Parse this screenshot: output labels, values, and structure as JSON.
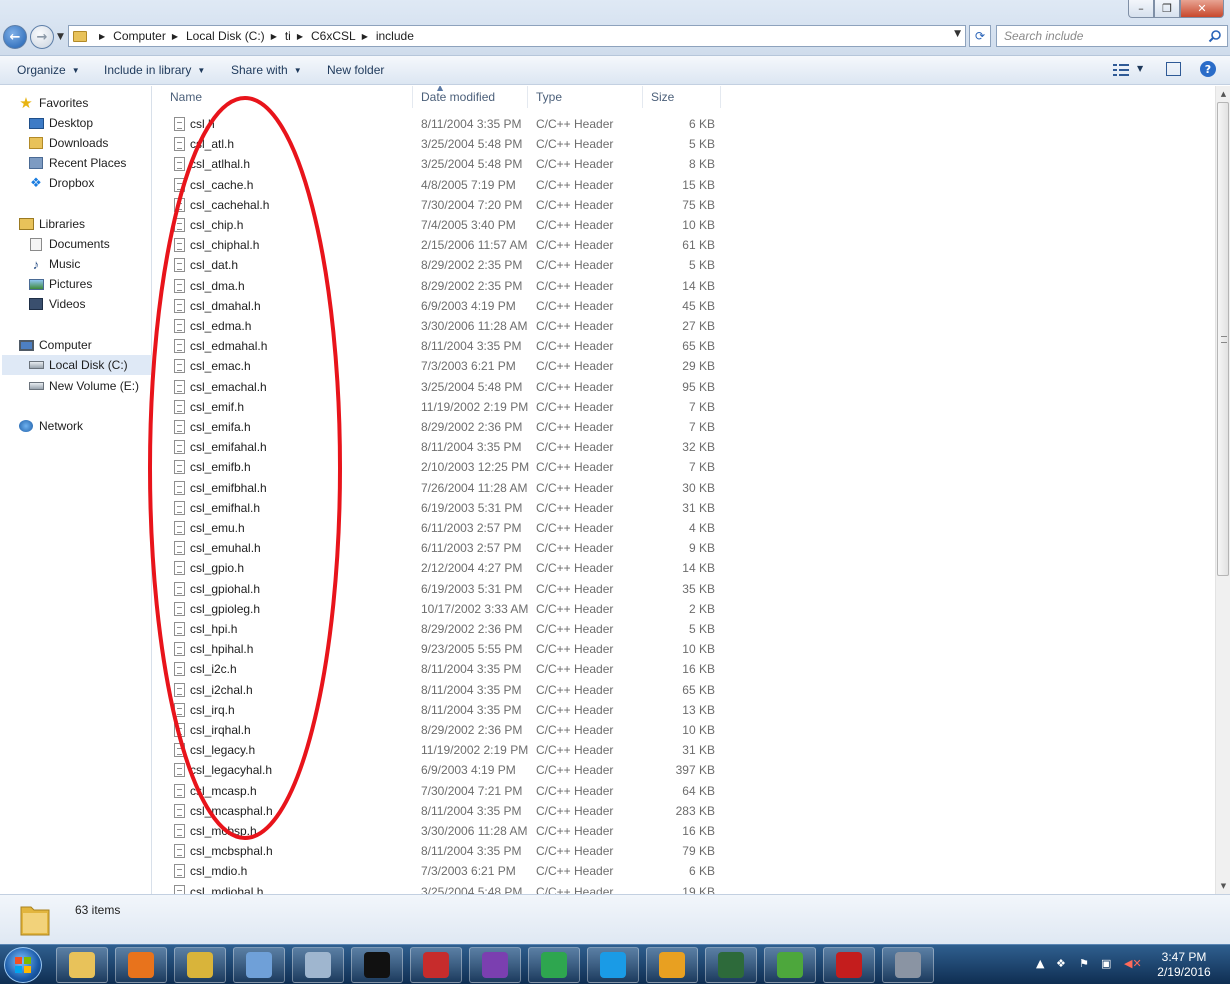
{
  "window": {
    "minimize": "–",
    "maximize": "❐",
    "close": "✕"
  },
  "address": {
    "breadcrumb": [
      "Computer",
      "Local Disk (C:)",
      "ti",
      "C6xCSL",
      "include"
    ],
    "search_placeholder": "Search include"
  },
  "toolbar": {
    "organize": "Organize",
    "include_in_library": "Include in library",
    "share_with": "Share with",
    "new_folder": "New folder"
  },
  "nav": {
    "favorites": "Favorites",
    "desktop": "Desktop",
    "downloads": "Downloads",
    "recent_places": "Recent Places",
    "dropbox": "Dropbox",
    "libraries": "Libraries",
    "documents": "Documents",
    "music": "Music",
    "pictures": "Pictures",
    "videos": "Videos",
    "computer": "Computer",
    "local_disk": "Local Disk (C:)",
    "new_volume": "New Volume (E:)",
    "network": "Network"
  },
  "columns": {
    "name": "Name",
    "date_modified": "Date modified",
    "type": "Type",
    "size": "Size"
  },
  "files": [
    {
      "name": "csl.h",
      "date": "8/11/2004 3:35 PM",
      "type": "C/C++ Header",
      "size": "6 KB"
    },
    {
      "name": "csl_atl.h",
      "date": "3/25/2004 5:48 PM",
      "type": "C/C++ Header",
      "size": "5 KB"
    },
    {
      "name": "csl_atlhal.h",
      "date": "3/25/2004 5:48 PM",
      "type": "C/C++ Header",
      "size": "8 KB"
    },
    {
      "name": "csl_cache.h",
      "date": "4/8/2005 7:19 PM",
      "type": "C/C++ Header",
      "size": "15 KB"
    },
    {
      "name": "csl_cachehal.h",
      "date": "7/30/2004 7:20 PM",
      "type": "C/C++ Header",
      "size": "75 KB"
    },
    {
      "name": "csl_chip.h",
      "date": "7/4/2005 3:40 PM",
      "type": "C/C++ Header",
      "size": "10 KB"
    },
    {
      "name": "csl_chiphal.h",
      "date": "2/15/2006 11:57 AM",
      "type": "C/C++ Header",
      "size": "61 KB"
    },
    {
      "name": "csl_dat.h",
      "date": "8/29/2002 2:35 PM",
      "type": "C/C++ Header",
      "size": "5 KB"
    },
    {
      "name": "csl_dma.h",
      "date": "8/29/2002 2:35 PM",
      "type": "C/C++ Header",
      "size": "14 KB"
    },
    {
      "name": "csl_dmahal.h",
      "date": "6/9/2003 4:19 PM",
      "type": "C/C++ Header",
      "size": "45 KB"
    },
    {
      "name": "csl_edma.h",
      "date": "3/30/2006 11:28 AM",
      "type": "C/C++ Header",
      "size": "27 KB"
    },
    {
      "name": "csl_edmahal.h",
      "date": "8/11/2004 3:35 PM",
      "type": "C/C++ Header",
      "size": "65 KB"
    },
    {
      "name": "csl_emac.h",
      "date": "7/3/2003 6:21 PM",
      "type": "C/C++ Header",
      "size": "29 KB"
    },
    {
      "name": "csl_emachal.h",
      "date": "3/25/2004 5:48 PM",
      "type": "C/C++ Header",
      "size": "95 KB"
    },
    {
      "name": "csl_emif.h",
      "date": "11/19/2002 2:19 PM",
      "type": "C/C++ Header",
      "size": "7 KB"
    },
    {
      "name": "csl_emifa.h",
      "date": "8/29/2002 2:36 PM",
      "type": "C/C++ Header",
      "size": "7 KB"
    },
    {
      "name": "csl_emifahal.h",
      "date": "8/11/2004 3:35 PM",
      "type": "C/C++ Header",
      "size": "32 KB"
    },
    {
      "name": "csl_emifb.h",
      "date": "2/10/2003 12:25 PM",
      "type": "C/C++ Header",
      "size": "7 KB"
    },
    {
      "name": "csl_emifbhal.h",
      "date": "7/26/2004 11:28 AM",
      "type": "C/C++ Header",
      "size": "30 KB"
    },
    {
      "name": "csl_emifhal.h",
      "date": "6/19/2003 5:31 PM",
      "type": "C/C++ Header",
      "size": "31 KB"
    },
    {
      "name": "csl_emu.h",
      "date": "6/11/2003 2:57 PM",
      "type": "C/C++ Header",
      "size": "4 KB"
    },
    {
      "name": "csl_emuhal.h",
      "date": "6/11/2003 2:57 PM",
      "type": "C/C++ Header",
      "size": "9 KB"
    },
    {
      "name": "csl_gpio.h",
      "date": "2/12/2004 4:27 PM",
      "type": "C/C++ Header",
      "size": "14 KB"
    },
    {
      "name": "csl_gpiohal.h",
      "date": "6/19/2003 5:31 PM",
      "type": "C/C++ Header",
      "size": "35 KB"
    },
    {
      "name": "csl_gpioleg.h",
      "date": "10/17/2002 3:33 AM",
      "type": "C/C++ Header",
      "size": "2 KB"
    },
    {
      "name": "csl_hpi.h",
      "date": "8/29/2002 2:36 PM",
      "type": "C/C++ Header",
      "size": "5 KB"
    },
    {
      "name": "csl_hpihal.h",
      "date": "9/23/2005 5:55 PM",
      "type": "C/C++ Header",
      "size": "10 KB"
    },
    {
      "name": "csl_i2c.h",
      "date": "8/11/2004 3:35 PM",
      "type": "C/C++ Header",
      "size": "16 KB"
    },
    {
      "name": "csl_i2chal.h",
      "date": "8/11/2004 3:35 PM",
      "type": "C/C++ Header",
      "size": "65 KB"
    },
    {
      "name": "csl_irq.h",
      "date": "8/11/2004 3:35 PM",
      "type": "C/C++ Header",
      "size": "13 KB"
    },
    {
      "name": "csl_irqhal.h",
      "date": "8/29/2002 2:36 PM",
      "type": "C/C++ Header",
      "size": "10 KB"
    },
    {
      "name": "csl_legacy.h",
      "date": "11/19/2002 2:19 PM",
      "type": "C/C++ Header",
      "size": "31 KB"
    },
    {
      "name": "csl_legacyhal.h",
      "date": "6/9/2003 4:19 PM",
      "type": "C/C++ Header",
      "size": "397 KB"
    },
    {
      "name": "csl_mcasp.h",
      "date": "7/30/2004 7:21 PM",
      "type": "C/C++ Header",
      "size": "64 KB"
    },
    {
      "name": "csl_mcasphal.h",
      "date": "8/11/2004 3:35 PM",
      "type": "C/C++ Header",
      "size": "283 KB"
    },
    {
      "name": "csl_mcbsp.h",
      "date": "3/30/2006 11:28 AM",
      "type": "C/C++ Header",
      "size": "16 KB"
    },
    {
      "name": "csl_mcbsphal.h",
      "date": "8/11/2004 3:35 PM",
      "type": "C/C++ Header",
      "size": "79 KB"
    },
    {
      "name": "csl_mdio.h",
      "date": "7/3/2003 6:21 PM",
      "type": "C/C++ Header",
      "size": "6 KB"
    },
    {
      "name": "csl_mdiohal.h",
      "date": "3/25/2004 5:48 PM",
      "type": "C/C++ Header",
      "size": "19 KB"
    }
  ],
  "status": {
    "item_count": "63 items"
  },
  "taskbar": {
    "apps": [
      "windows-explorer",
      "firefox",
      "text-editor",
      "paint",
      "calculator",
      "command-prompt",
      "media-app",
      "wifi-app",
      "chrome",
      "skype",
      "outlook",
      "code-composer",
      "notepad-plus-plus",
      "acrobat",
      "virtualbox"
    ],
    "time": "3:47 PM",
    "date": "2/19/2016"
  },
  "colors": {
    "annotation": "#e8141b",
    "taskbar": "#1b406b",
    "accent": "#2a64b8"
  }
}
